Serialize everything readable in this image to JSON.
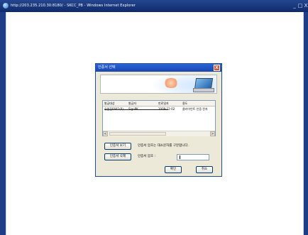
{
  "browser": {
    "title": "http://203.235.210.30:8180/ - SKCC_PB - Windows Internet Explorer",
    "min_label": "_",
    "max_label": "□",
    "close_label": "X"
  },
  "dialog": {
    "title": "인증서 선택",
    "close_label": "X",
    "list": {
      "headers": [
        "발급대상",
        "발급자",
        "만료일자",
        "용도"
      ],
      "rows": [
        {
          "subject": "유원진0041(0)…",
          "issuer": "SignPK",
          "expiry": "2009-12-02",
          "usage": "클라이언트 인증 전자"
        }
      ]
    },
    "scroll_left": "<",
    "scroll_right": ">",
    "view_cert_button": "인증서 보기",
    "delete_cert_button": "인증서 삭제",
    "hint_text": "인증서 암호는 대소문자를 구분합니다.",
    "password_label": "인증서 암호 :",
    "password_value": "",
    "ok_button": "확인",
    "cancel_button": "취소"
  }
}
